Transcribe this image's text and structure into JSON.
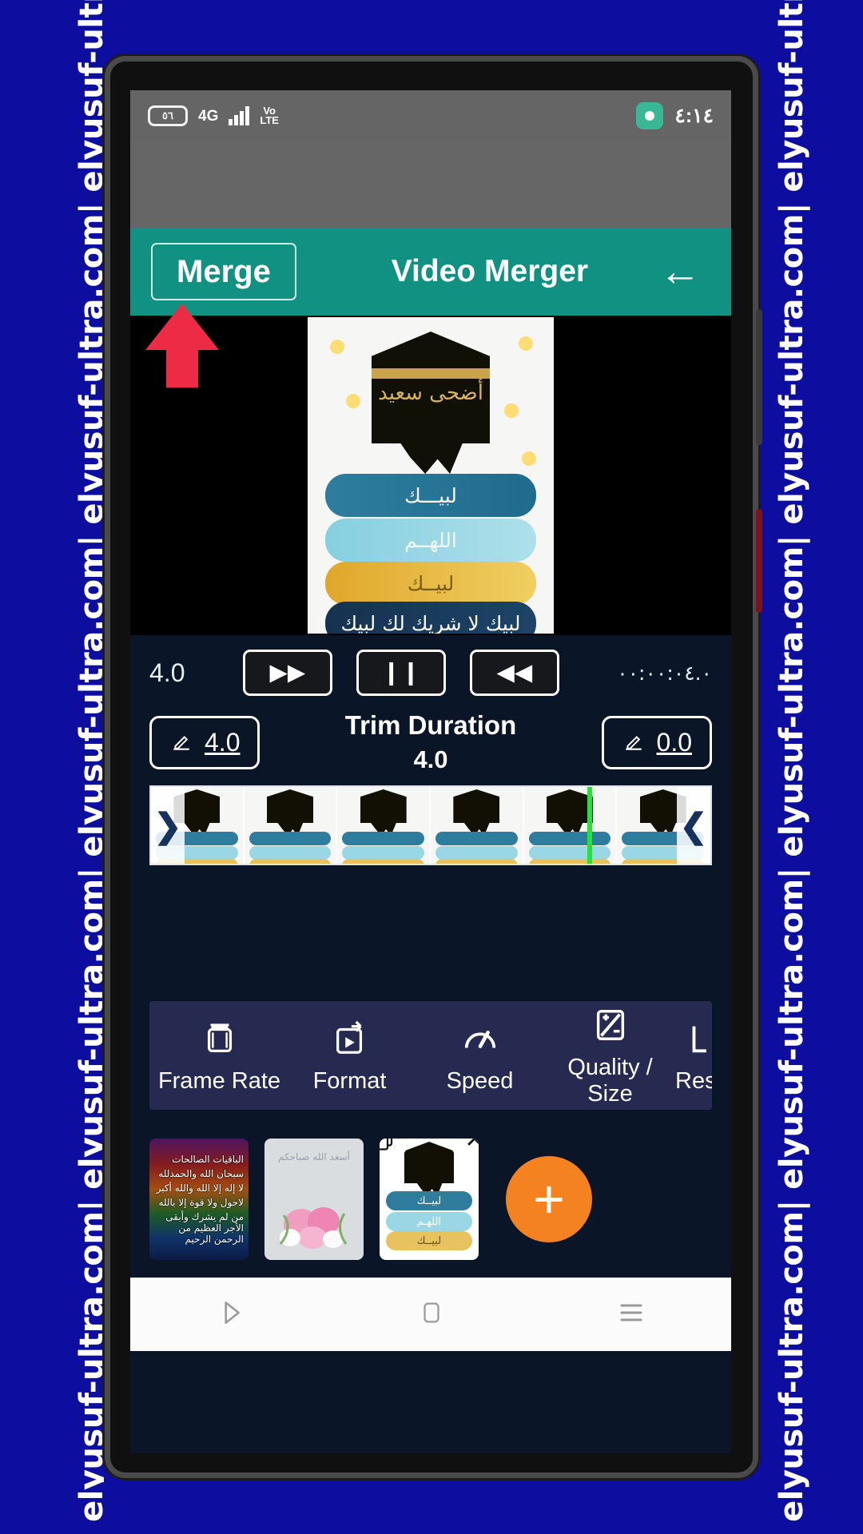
{
  "watermark": {
    "text": "elyusuf-ultra.com| elyusuf-ultra.com| elyusuf-ultra.com| elyusuf-ultra.com| elyusuf-ultra.com| elyusuf-ultra.com|"
  },
  "statusbar": {
    "battery_level": "٥٦",
    "network": "4G",
    "volte_top": "Vo",
    "volte_bottom": "LTE",
    "clock": "٤:١٤",
    "app_icon": "recording-indicator-icon"
  },
  "toolbar": {
    "merge_label": "Merge",
    "title": "Video Merger",
    "back_icon": "←"
  },
  "preview": {
    "brush_lines": [
      "لبيـــك",
      "اللهــم",
      "لبيــك",
      "لبيك لا شريك لك لبيك"
    ],
    "kaaba_text": "أضحى سعيد"
  },
  "controls": {
    "speed_value": "4.0",
    "forward_icon": "▶▶",
    "pause_icon": "❙❙",
    "rewind_icon": "◀◀",
    "timestamp": "٠٠:٠٠:٠٤.٠"
  },
  "trim": {
    "left_value": "4.0",
    "right_value": "0.0",
    "label": "Trim Duration",
    "value": "4.0",
    "edit_icon": "pencil-icon"
  },
  "filmstrip": {
    "handle_left": "❯",
    "handle_right": "❮",
    "frame_count": 6,
    "playhead_position_pct": 78
  },
  "options": [
    {
      "label": "Frame Rate",
      "icon": "film-reel-icon"
    },
    {
      "label": "Format",
      "icon": "format-export-icon"
    },
    {
      "label": "Speed",
      "icon": "speedometer-icon"
    },
    {
      "label": "Quality / Size",
      "icon": "plus-minus-icon"
    },
    {
      "label": "Reso",
      "icon": "resolution-icon"
    }
  ],
  "clips": [
    {
      "name": "clip-baqiyat",
      "lines": [
        "الباقيات الصالحات",
        "سبحان الله والحمدلله",
        "لا إله إلا الله والله أكبر",
        "لاحول ولا قوة إلا بالله",
        "من لم يشرك وأبقى الأجر العظيم من الرحمن الرحيم"
      ]
    },
    {
      "name": "clip-roses",
      "header": "أسعد الله صباحكم"
    },
    {
      "name": "clip-labbayk",
      "lines": [
        "لبيــك",
        "اللهـم",
        "لبيــك"
      ],
      "selected": true
    }
  ],
  "clip_actions": {
    "copy_icon": "duplicate-icon",
    "close_icon": "✕"
  },
  "fab": {
    "label": "+",
    "color": "#f58220"
  },
  "navbar": {
    "back_icon": "nav-back-triangle-icon",
    "home_icon": "nav-home-square-icon",
    "recents_icon": "nav-recents-lines-icon"
  },
  "colors": {
    "accent_teal": "#119181",
    "app_bg": "#0a1628",
    "options_bg": "#262a50",
    "fab_orange": "#f58220",
    "playhead_green": "#22e432",
    "pointer_red": "#ee2b45",
    "watermark_blue": "#0d0da0"
  }
}
